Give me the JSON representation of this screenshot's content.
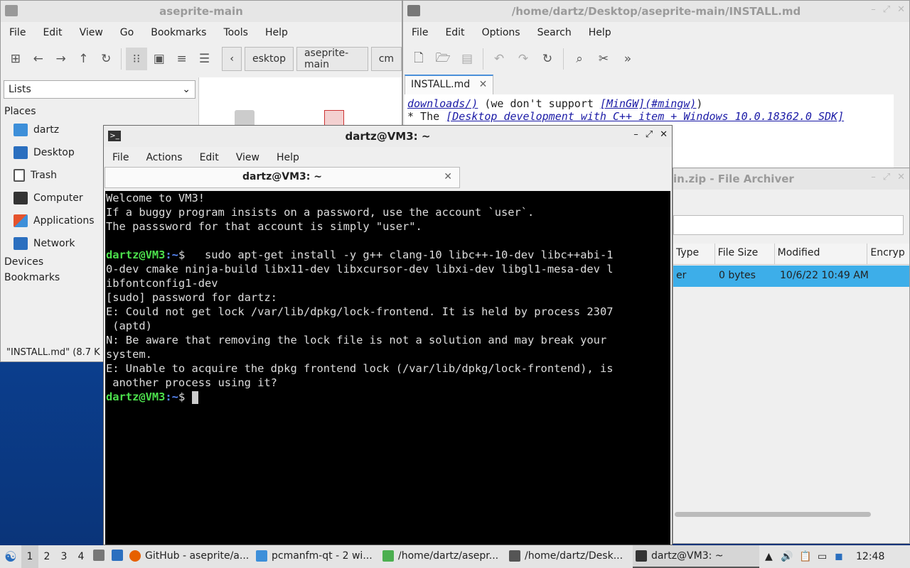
{
  "file_manager": {
    "title": "aseprite-main",
    "menu": [
      "File",
      "Edit",
      "View",
      "Go",
      "Bookmarks",
      "Tools",
      "Help"
    ],
    "crumbs": [
      "esktop",
      "aseprite-main",
      "cm"
    ],
    "view_mode": "Lists",
    "places_header": "Places",
    "places": [
      {
        "label": "dartz",
        "icon": "home-folder-icon",
        "color": "#3d8fd9"
      },
      {
        "label": "Desktop",
        "icon": "desktop-icon",
        "color": "#2b6fbf"
      },
      {
        "label": "Trash",
        "icon": "trash-icon",
        "color": "#555555"
      },
      {
        "label": "Computer",
        "icon": "computer-icon",
        "color": "#333333"
      },
      {
        "label": "Applications",
        "icon": "applications-icon",
        "color": "#e5532d"
      },
      {
        "label": "Network",
        "icon": "network-icon",
        "color": "#2b6fbf"
      }
    ],
    "devices_header": "Devices",
    "bookmarks_header": "Bookmarks",
    "status": "\"INSTALL.md\" (8.7 K"
  },
  "editor": {
    "title": "/home/dartz/Desktop/aseprite-main/INSTALL.md",
    "menu": [
      "File",
      "Edit",
      "Options",
      "Search",
      "Help"
    ],
    "tab": "INSTALL.md",
    "line1_link": "downloads/)",
    "line1_text": " (we don't support ",
    "line1_link2": "[MinGW](#mingw)",
    "line1_end": ")",
    "line2_prefix": "* The ",
    "line2_link": "[Desktop development with C++ item + Windows 10.0.18362.0 SDK]"
  },
  "archiver": {
    "title": "in.zip - File Archiver",
    "columns": [
      "Type",
      "File Size",
      "Modified",
      "Encryp"
    ],
    "row": [
      "er",
      "0 bytes",
      "10/6/22 10:49 AM",
      ""
    ]
  },
  "terminal": {
    "title": "dartz@VM3: ~",
    "menu": [
      "File",
      "Actions",
      "Edit",
      "View",
      "Help"
    ],
    "tab": "dartz@VM3: ~",
    "prompt_user": "dartz@VM3",
    "prompt_path": ":~",
    "prompt_sym": "$",
    "lines": [
      "Welcome to VM3!",
      "If a buggy program insists on a password, use the account `user`.",
      "The passsword for that account is simply \"user\".",
      ""
    ],
    "command": "   sudo apt-get install -y g++ clang-10 libc++-10-dev libc++abi-1",
    "output": [
      "0-dev cmake ninja-build libx11-dev libxcursor-dev libxi-dev libgl1-mesa-dev l",
      "ibfontconfig1-dev",
      "[sudo] password for dartz:",
      "E: Could not get lock /var/lib/dpkg/lock-frontend. It is held by process 2307",
      " (aptd)",
      "N: Be aware that removing the lock file is not a solution and may break your",
      "system.",
      "E: Unable to acquire the dpkg frontend lock (/var/lib/dpkg/lock-frontend), is",
      " another process using it?"
    ]
  },
  "taskbar": {
    "workspaces": [
      "1",
      "2",
      "3",
      "4"
    ],
    "tasks": [
      {
        "label": "GitHub - aseprite/a...",
        "icon": "firefox-icon",
        "color": "#e66000"
      },
      {
        "label": "pcmanfm-qt - 2 wi...",
        "icon": "folder-icon",
        "color": "#3d8fd9"
      },
      {
        "label": "/home/dartz/asepr...",
        "icon": "archive-icon",
        "color": "#4caf50"
      },
      {
        "label": "/home/dartz/Desk...",
        "icon": "text-editor-icon",
        "color": "#555555"
      },
      {
        "label": "dartz@VM3: ~",
        "icon": "terminal-icon",
        "color": "#333333"
      }
    ],
    "clock": "12:48"
  }
}
